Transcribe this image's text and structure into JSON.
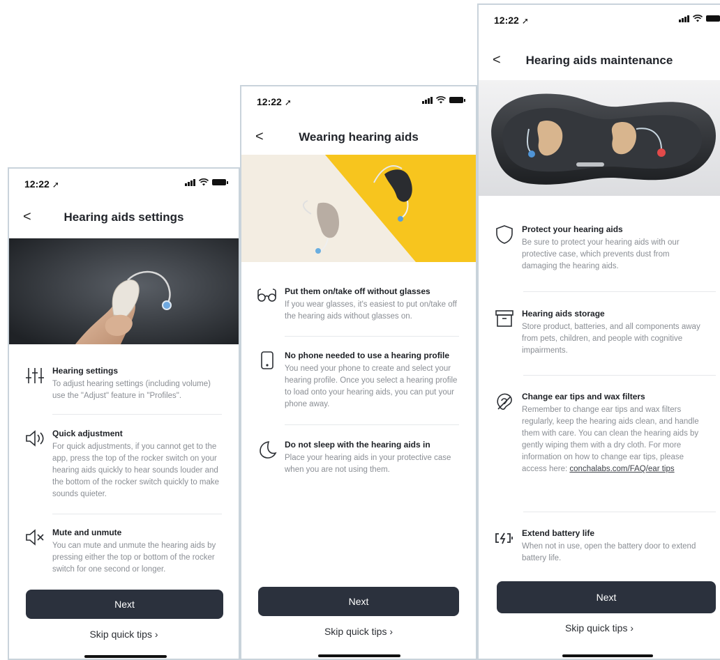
{
  "status": {
    "time": "12:22",
    "arrow": "➚"
  },
  "common": {
    "next_label": "Next",
    "skip_label": "Skip quick tips",
    "skip_chevron": "›",
    "back_glyph": "<"
  },
  "screen1": {
    "title": "Hearing aids settings",
    "tips": [
      {
        "icon": "sliders-icon",
        "title": "Hearing settings",
        "desc": "To adjust hearing settings (including volume) use the \"Adjust\" feature in \"Profiles\"."
      },
      {
        "icon": "speaker-icon",
        "title": "Quick adjustment",
        "desc": "For quick adjustments, if you cannot get to the app, press the top of the rocker switch on your hearing aids quickly to hear sounds louder and the bottom of the rocker switch quickly to make sounds quieter."
      },
      {
        "icon": "mute-icon",
        "title": "Mute and unmute",
        "desc": "You can mute and unmute the hearing aids by pressing either the top or bottom of the rocker switch for one second or longer."
      }
    ]
  },
  "screen2": {
    "title": "Wearing hearing aids",
    "tips": [
      {
        "icon": "glasses-icon",
        "title": "Put them on/take off without glasses",
        "desc": "If you wear glasses, it's easiest to put on/take off the hearing aids without glasses on."
      },
      {
        "icon": "phone-icon",
        "title": "No phone needed to use a hearing profile",
        "desc": "You need your phone to create and select your hearing profile. Once you select a hearing profile to load onto your hearing aids, you can put your phone away."
      },
      {
        "icon": "moon-icon",
        "title": "Do not sleep with the hearing aids in",
        "desc": "Place your hearing aids in your protective case when you are not using them."
      }
    ]
  },
  "screen3": {
    "title": "Hearing aids maintenance",
    "tips": [
      {
        "icon": "shield-icon",
        "title": "Protect your hearing aids",
        "desc": "Be sure to protect your hearing aids with our protective case, which prevents dust from damaging the hearing aids."
      },
      {
        "icon": "storage-box-icon",
        "title": "Hearing aids storage",
        "desc": "Store product, batteries, and all components away from pets, children, and people with cognitive impairments."
      },
      {
        "icon": "ear-icon",
        "title": "Change ear tips and wax filters",
        "desc": "Remember to change ear tips and wax filters regularly, keep the hearing aids clean, and handle them with care. You can clean the hearing aids by gently wiping them with a dry cloth. For more information on how to change ear tips, please access here:",
        "link": "conchalabs.com/FAQ/ear tips"
      },
      {
        "icon": "battery-charge-icon",
        "title": "Extend battery life",
        "desc": "When not in use, open the battery door to extend battery life."
      }
    ]
  },
  "colors": {
    "button": "#2b313d",
    "accent_yellow": "#f7c51e",
    "muted_text": "#8a8e94"
  }
}
